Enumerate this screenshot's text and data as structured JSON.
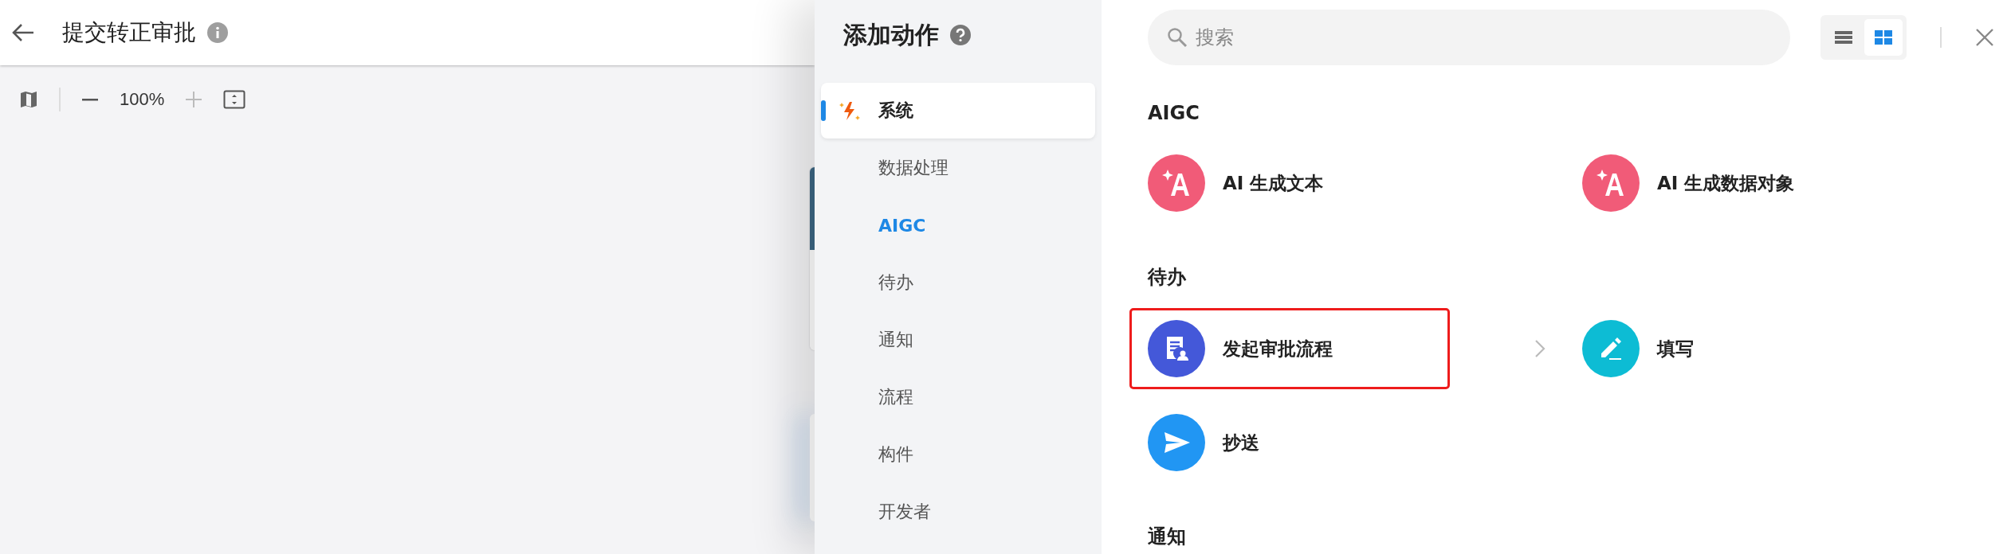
{
  "header": {
    "title": "提交转正审批"
  },
  "canvas_toolbar": {
    "zoom": "100%"
  },
  "drawer": {
    "title": "添加动作",
    "categories": [
      {
        "label": "系统",
        "selected": true,
        "kind": "system"
      },
      {
        "label": "数据处理",
        "selected": false,
        "kind": "plain"
      },
      {
        "label": "AIGC",
        "selected": false,
        "kind": "active"
      },
      {
        "label": "待办",
        "selected": false,
        "kind": "plain"
      },
      {
        "label": "通知",
        "selected": false,
        "kind": "plain"
      },
      {
        "label": "流程",
        "selected": false,
        "kind": "plain"
      },
      {
        "label": "构件",
        "selected": false,
        "kind": "plain"
      },
      {
        "label": "开发者",
        "selected": false,
        "kind": "plain"
      }
    ],
    "search": {
      "placeholder": "搜索"
    },
    "view_modes": [
      {
        "kind": "list",
        "selected": false
      },
      {
        "kind": "grid",
        "selected": true
      }
    ],
    "sections": [
      {
        "title": "AIGC",
        "actions": [
          {
            "label": "AI 生成文本",
            "kind": "ai",
            "color": "#f15b78",
            "highlighted": false
          },
          {
            "label": "AI 生成数据对象",
            "kind": "ai",
            "color": "#f15b78",
            "highlighted": false
          }
        ]
      },
      {
        "title": "待办",
        "actions": [
          {
            "label": "发起审批流程",
            "kind": "approval",
            "color": "#4458d9",
            "highlighted": true,
            "chevron": true
          },
          {
            "label": "填写",
            "kind": "edit",
            "color": "#0dbcd4",
            "highlighted": false
          },
          {
            "label": "抄送",
            "kind": "send",
            "color": "#2196f3",
            "highlighted": false
          }
        ]
      },
      {
        "title": "通知"
      }
    ]
  }
}
